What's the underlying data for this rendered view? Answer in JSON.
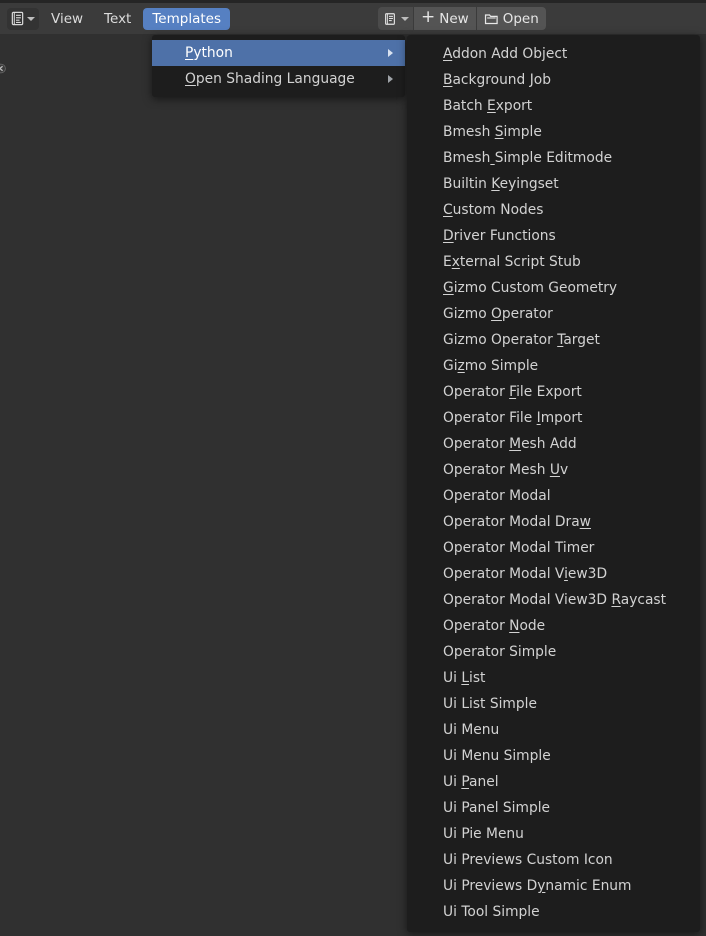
{
  "header": {
    "editor_type_icon": "text-editor-icon",
    "editor_type_chevron": "chevron-down-icon",
    "menus": [
      {
        "label": "View",
        "accel": null,
        "active": false
      },
      {
        "label": "Text",
        "accel": null,
        "active": false
      },
      {
        "label": "Templates",
        "accel": null,
        "active": true
      }
    ],
    "datablock": {
      "selector_icon": "text-datablock-icon",
      "selector_chevron": "chevron-down-icon",
      "new_icon": "plus-icon",
      "new_label": "New",
      "open_icon": "folder-open-icon",
      "open_label": "Open"
    }
  },
  "body": {
    "region_toggle_icon": "region-toggle-arrow-icon"
  },
  "templates_menu": {
    "items": [
      {
        "label": "Python",
        "accel": 0,
        "highlighted": true,
        "has_submenu": true
      },
      {
        "label": "Open Shading Language",
        "accel": 0,
        "highlighted": false,
        "has_submenu": true
      }
    ]
  },
  "python_menu": {
    "items": [
      {
        "label": "Addon Add Object",
        "accel": 0
      },
      {
        "label": "Background Job",
        "accel": 0
      },
      {
        "label": "Batch Export",
        "accel": 6
      },
      {
        "label": "Bmesh Simple",
        "accel": 6
      },
      {
        "label": "Bmesh Simple Editmode",
        "accel": 5
      },
      {
        "label": "Builtin Keyingset",
        "accel": 8
      },
      {
        "label": "Custom Nodes",
        "accel": 0
      },
      {
        "label": "Driver Functions",
        "accel": 0
      },
      {
        "label": "External Script Stub",
        "accel": 1
      },
      {
        "label": "Gizmo Custom Geometry",
        "accel": 0
      },
      {
        "label": "Gizmo Operator",
        "accel": 6
      },
      {
        "label": "Gizmo Operator Target",
        "accel": 15
      },
      {
        "label": "Gizmo Simple",
        "accel": 2
      },
      {
        "label": "Operator File Export",
        "accel": 9
      },
      {
        "label": "Operator File Import",
        "accel": 14
      },
      {
        "label": "Operator Mesh Add",
        "accel": 9
      },
      {
        "label": "Operator Mesh Uv",
        "accel": 14
      },
      {
        "label": "Operator Modal",
        "accel": null
      },
      {
        "label": "Operator Modal Draw",
        "accel": 18
      },
      {
        "label": "Operator Modal Timer",
        "accel": null
      },
      {
        "label": "Operator Modal View3D",
        "accel": 16
      },
      {
        "label": "Operator Modal View3D Raycast",
        "accel": 22
      },
      {
        "label": "Operator Node",
        "accel": 9
      },
      {
        "label": "Operator Simple",
        "accel": null
      },
      {
        "label": "Ui List",
        "accel": 3
      },
      {
        "label": "Ui List Simple",
        "accel": null
      },
      {
        "label": "Ui Menu",
        "accel": null
      },
      {
        "label": "Ui Menu Simple",
        "accel": null
      },
      {
        "label": "Ui Panel",
        "accel": 3
      },
      {
        "label": "Ui Panel Simple",
        "accel": null
      },
      {
        "label": "Ui Pie Menu",
        "accel": null
      },
      {
        "label": "Ui Previews Custom Icon",
        "accel": null
      },
      {
        "label": "Ui Previews Dynamic Enum",
        "accel": 13
      },
      {
        "label": "Ui Tool Simple",
        "accel": null
      }
    ]
  },
  "colors": {
    "header_bg": "#3b3b3b",
    "editor_bg": "#303030",
    "menu_bg": "#1d1d1d",
    "accent_blue": "#5680c2",
    "menu_highlight": "#4e71a8",
    "text": "#d2d2d2"
  }
}
